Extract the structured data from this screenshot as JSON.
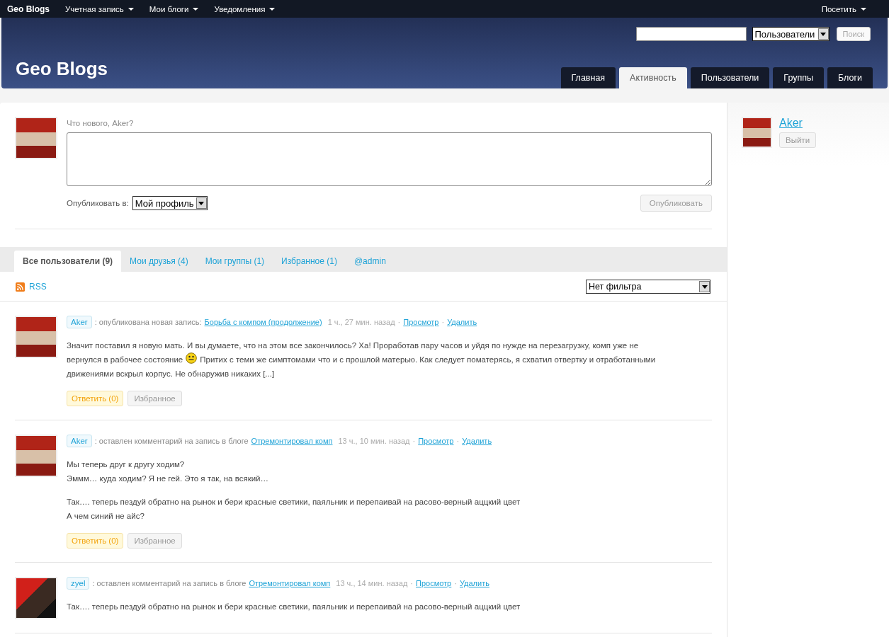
{
  "adminbar": {
    "brand": "Geo Blogs",
    "menus": [
      {
        "label": "Учетная запись"
      },
      {
        "label": "Мои блоги"
      },
      {
        "label": "Уведомления"
      }
    ],
    "right_menu": {
      "label": "Посетить"
    }
  },
  "header": {
    "title": "Geo Blogs",
    "search": {
      "scope": "Пользователи",
      "button": "Поиск"
    },
    "nav": [
      {
        "label": "Главная",
        "selected": false
      },
      {
        "label": "Активность",
        "selected": true
      },
      {
        "label": "Пользователи",
        "selected": false
      },
      {
        "label": "Группы",
        "selected": false
      },
      {
        "label": "Блоги",
        "selected": false
      }
    ]
  },
  "post_form": {
    "prompt": "Что нового, Aker?",
    "post_in_label": "Опубликовать в:",
    "post_in_value": "Мой профиль",
    "submit": "Опубликовать"
  },
  "activity_tabs": [
    {
      "label": "Все пользователи (9)",
      "selected": true
    },
    {
      "label": "Мои друзья (4)",
      "selected": false
    },
    {
      "label": "Мои группы (1)",
      "selected": false
    },
    {
      "label": "Избранное (1)",
      "selected": false
    },
    {
      "label": "@admin",
      "selected": false
    }
  ],
  "rss": "RSS",
  "filter": "Нет фильтра",
  "activities": [
    {
      "user": "Aker",
      "avatar": {
        "kind": "santa"
      },
      "action": ": опубликована новая запись:",
      "link": "Борьба с компом (продолжение)",
      "time": "1 ч., 27 мин. назад",
      "separators": [
        "·",
        "·"
      ],
      "view": "Просмотр",
      "delete": "Удалить",
      "paragraphs": [
        [
          {
            "kind": "text",
            "text": "Значит поставил я новую мать. И вы думаете, что на этом все закончилось? Ха! Проработав пару часов и уйдя по нужде на перезагрузку, комп уже не"
          }
        ],
        [
          {
            "kind": "text",
            "text": "вернулся в рабочее состояние"
          },
          {
            "kind": "smiley"
          },
          {
            "kind": "text",
            "text": "Притих с теми же симптомами что и с прошлой матерью. Как следует поматерясь, я схватил отвертку и отработанными"
          }
        ],
        [
          {
            "kind": "text",
            "text": "движениями вскрыл корпус. Не обнаружив никаких [...]"
          }
        ]
      ],
      "reply": "Ответить (0)",
      "favorite": "Избранное"
    },
    {
      "user": "Aker",
      "avatar": {
        "kind": "santa"
      },
      "action": ": оставлен комментарий на запись в блоге",
      "link": "Отремонтировал комп",
      "time": "13 ч., 10 мин. назад",
      "separators": [
        "·",
        "·"
      ],
      "view": "Просмотр",
      "delete": "Удалить",
      "paragraphs": [
        [
          {
            "kind": "text",
            "text": "Мы теперь друг к другу ходим?"
          }
        ],
        [
          {
            "kind": "text",
            "text": "Эммм… куда ходим? Я не гей. Это я так, на всякий…"
          }
        ],
        [
          {
            "kind": "gap"
          }
        ],
        [
          {
            "kind": "text",
            "text": "Так…. теперь пездуй обратно на рынок и бери красные светики, паяльник и перепаивай на расово-верный аццкий цвет"
          }
        ],
        [
          {
            "kind": "text",
            "text": "А чем синий не айс?"
          }
        ]
      ],
      "reply": "Ответить (0)",
      "favorite": "Избранное"
    },
    {
      "user": "zyel",
      "avatar": {
        "kind": "red"
      },
      "action": ": оставлен комментарий на запись в блоге",
      "link": "Отремонтировал комп",
      "time": "13 ч., 14 мин. назад",
      "separators": [
        "·",
        "·"
      ],
      "view": "Просмотр",
      "delete": "Удалить",
      "paragraphs": [
        [
          {
            "kind": "text",
            "text": "Так…. теперь пездуй обратно на рынок и бери красные светики, паяльник и перепаивай на расово-верный аццкий цвет"
          }
        ]
      ]
    }
  ],
  "sidebar": {
    "user": "Aker",
    "logout": "Выйти"
  }
}
